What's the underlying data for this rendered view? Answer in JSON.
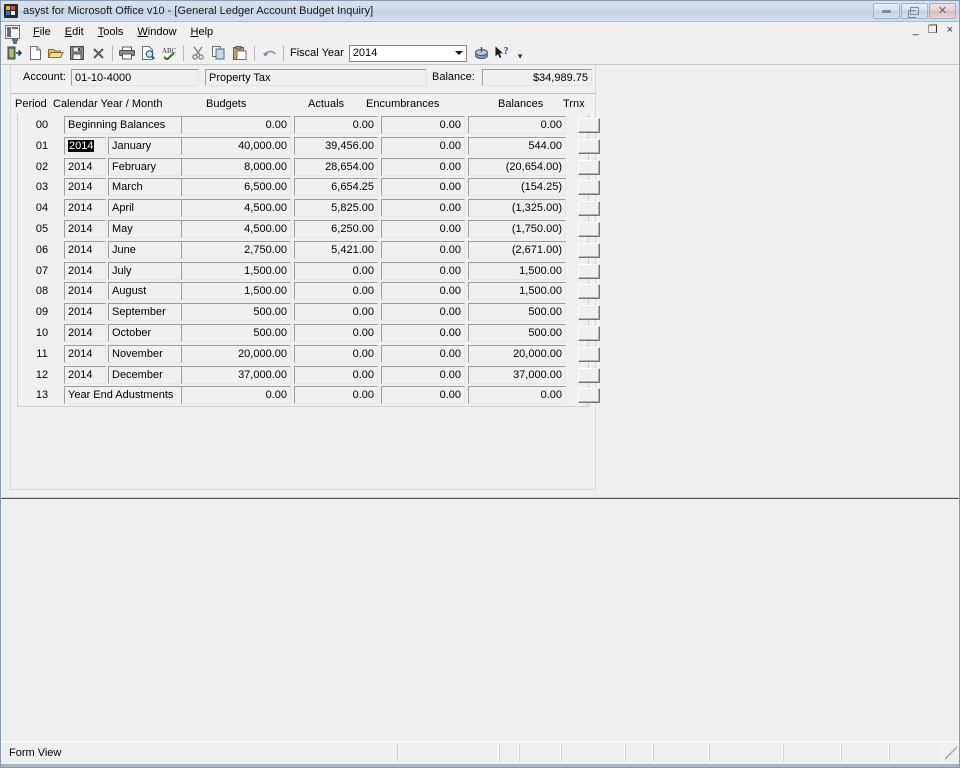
{
  "window": {
    "title": "asyst for Microsoft Office v10 - [General Ledger Account Budget Inquiry]",
    "app_icon": "asyst-app-icon",
    "controls": {
      "minimize": "minimize",
      "restore": "restore",
      "close": "close"
    }
  },
  "mdi_controls": {
    "minimize": "_",
    "restore": "❐",
    "close": "×"
  },
  "menu": {
    "items": [
      {
        "label": "File",
        "accel": "F"
      },
      {
        "label": "Edit",
        "accel": "E"
      },
      {
        "label": "Tools",
        "accel": "T"
      },
      {
        "label": "Window",
        "accel": "W"
      },
      {
        "label": "Help",
        "accel": "H"
      }
    ]
  },
  "toolbar": {
    "buttons": [
      {
        "name": "exit-icon",
        "tip": "Exit"
      },
      {
        "name": "new-icon",
        "tip": "New"
      },
      {
        "name": "open-folder-icon",
        "tip": "Open"
      },
      {
        "name": "save-icon",
        "tip": "Save"
      },
      {
        "name": "delete-icon",
        "tip": "Delete"
      },
      {
        "name": "print-icon",
        "tip": "Print"
      },
      {
        "name": "print-preview-icon",
        "tip": "Print Preview"
      },
      {
        "name": "spellcheck-icon",
        "tip": "Spelling"
      },
      {
        "name": "cut-icon",
        "tip": "Cut"
      },
      {
        "name": "copy-icon",
        "tip": "Copy"
      },
      {
        "name": "paste-icon",
        "tip": "Paste"
      },
      {
        "name": "undo-icon",
        "tip": "Undo"
      }
    ],
    "fiscal_year_label": "Fiscal Year",
    "fiscal_year_value": "2014",
    "help-lookup-icon": "lookup-icon",
    "help-context-icon": "help-pointer-icon",
    "overflow": "▾"
  },
  "form": {
    "account_label": "Account:",
    "account_number": "01-10-4000",
    "account_name": "Property Tax",
    "balance_label": "Balance:",
    "balance_value": "$34,989.75",
    "columns": {
      "period": "Period",
      "calendar": "Calendar Year / Month",
      "budgets": "Budgets",
      "actuals": "Actuals",
      "encumbrances": "Encumbrances",
      "balances": "Balances",
      "trnx": "Trnx"
    },
    "rows": [
      {
        "period": "00",
        "year": "",
        "month": "",
        "wide": "Beginning Balances",
        "budget": "0.00",
        "actual": "0.00",
        "encumbrance": "0.00",
        "balance": "0.00",
        "selected": false
      },
      {
        "period": "01",
        "year": "2014",
        "month": "January",
        "wide": "",
        "budget": "40,000.00",
        "actual": "39,456.00",
        "encumbrance": "0.00",
        "balance": "544.00",
        "selected": true
      },
      {
        "period": "02",
        "year": "2014",
        "month": "February",
        "wide": "",
        "budget": "8,000.00",
        "actual": "28,654.00",
        "encumbrance": "0.00",
        "balance": "(20,654.00)",
        "selected": false
      },
      {
        "period": "03",
        "year": "2014",
        "month": "March",
        "wide": "",
        "budget": "6,500.00",
        "actual": "6,654.25",
        "encumbrance": "0.00",
        "balance": "(154.25)",
        "selected": false
      },
      {
        "period": "04",
        "year": "2014",
        "month": "April",
        "wide": "",
        "budget": "4,500.00",
        "actual": "5,825.00",
        "encumbrance": "0.00",
        "balance": "(1,325.00)",
        "selected": false
      },
      {
        "period": "05",
        "year": "2014",
        "month": "May",
        "wide": "",
        "budget": "4,500.00",
        "actual": "6,250.00",
        "encumbrance": "0.00",
        "balance": "(1,750.00)",
        "selected": false
      },
      {
        "period": "06",
        "year": "2014",
        "month": "June",
        "wide": "",
        "budget": "2,750.00",
        "actual": "5,421.00",
        "encumbrance": "0.00",
        "balance": "(2,671.00)",
        "selected": false
      },
      {
        "period": "07",
        "year": "2014",
        "month": "July",
        "wide": "",
        "budget": "1,500.00",
        "actual": "0.00",
        "encumbrance": "0.00",
        "balance": "1,500.00",
        "selected": false
      },
      {
        "period": "08",
        "year": "2014",
        "month": "August",
        "wide": "",
        "budget": "1,500.00",
        "actual": "0.00",
        "encumbrance": "0.00",
        "balance": "1,500.00",
        "selected": false
      },
      {
        "period": "09",
        "year": "2014",
        "month": "September",
        "wide": "",
        "budget": "500.00",
        "actual": "0.00",
        "encumbrance": "0.00",
        "balance": "500.00",
        "selected": false
      },
      {
        "period": "10",
        "year": "2014",
        "month": "October",
        "wide": "",
        "budget": "500.00",
        "actual": "0.00",
        "encumbrance": "0.00",
        "balance": "500.00",
        "selected": false
      },
      {
        "period": "11",
        "year": "2014",
        "month": "November",
        "wide": "",
        "budget": "20,000.00",
        "actual": "0.00",
        "encumbrance": "0.00",
        "balance": "20,000.00",
        "selected": false
      },
      {
        "period": "12",
        "year": "2014",
        "month": "December",
        "wide": "",
        "budget": "37,000.00",
        "actual": "0.00",
        "encumbrance": "0.00",
        "balance": "37,000.00",
        "selected": false
      },
      {
        "period": "13",
        "year": "",
        "month": "",
        "wide": "Year End Adustments",
        "budget": "0.00",
        "actual": "0.00",
        "encumbrance": "0.00",
        "balance": "0.00",
        "selected": false
      }
    ]
  },
  "status": {
    "text": "Form View",
    "panel_count": 9
  },
  "colors": {
    "face": "#f0f0f0",
    "title_gradient_top": "#d6e3f0",
    "title_gradient_bottom": "#c2d3e6",
    "selection_bg": "#000000",
    "selection_fg": "#ffffff",
    "field_border": "#9c9c9c",
    "window_edge": "#8a9aab"
  }
}
